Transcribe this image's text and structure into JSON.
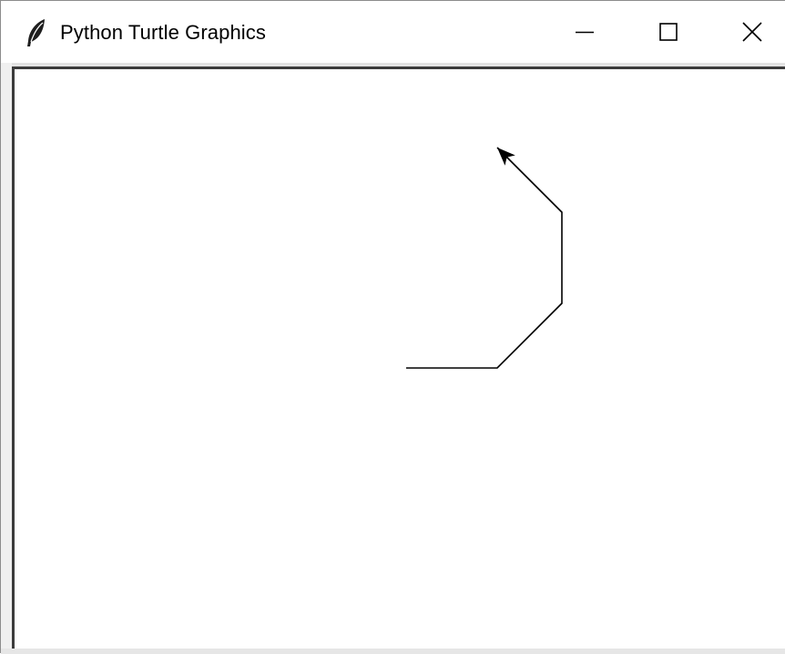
{
  "window": {
    "title": "Python Turtle Graphics",
    "icon": "feather-icon",
    "controls": {
      "minimize": "minimize-icon",
      "maximize": "maximize-icon",
      "close": "close-icon"
    }
  },
  "canvas": {
    "background": "#ffffff",
    "pen_color": "#000000",
    "turtle_color": "#000000",
    "turtle_shape": "classic-arrow-icon",
    "path_points": [
      [
        -100,
        0
      ],
      [
        0,
        0
      ],
      [
        71,
        71
      ],
      [
        71,
        171
      ],
      [
        0,
        242
      ]
    ]
  }
}
